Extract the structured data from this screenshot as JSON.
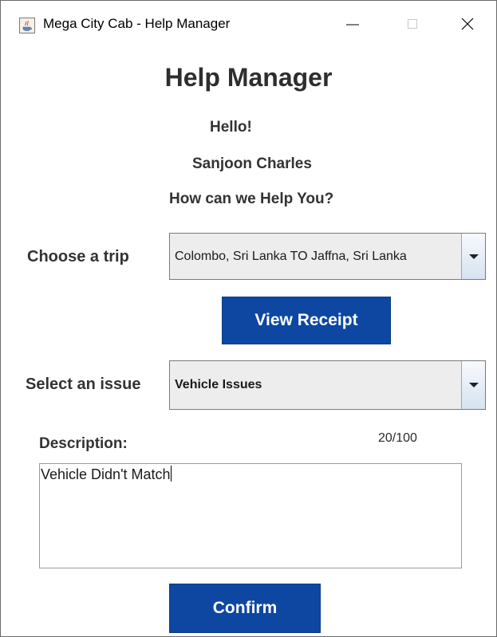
{
  "window": {
    "title": "Mega City Cab - Help Manager",
    "icon": "java-cup-icon",
    "controls": [
      "minimize-icon",
      "maximize-icon",
      "close-icon"
    ]
  },
  "header": {
    "title": "Help Manager",
    "greeting": "Hello!",
    "user_name": "Sanjoon Charles",
    "prompt": "How can we Help You?"
  },
  "trip": {
    "label": "Choose a trip",
    "selected": "Colombo, Sri Lanka TO Jaffna, Sri Lanka"
  },
  "receipt_button": "View Receipt",
  "issue": {
    "label": "Select an issue",
    "selected": "Vehicle Issues"
  },
  "description": {
    "label": "Description:",
    "counter": "20/100",
    "value": "Vehicle Didn't Match"
  },
  "confirm_button": "Confirm",
  "colors": {
    "button_blue": "#0d47a1",
    "text_dark": "#333333",
    "combo_bg": "#ededed"
  }
}
